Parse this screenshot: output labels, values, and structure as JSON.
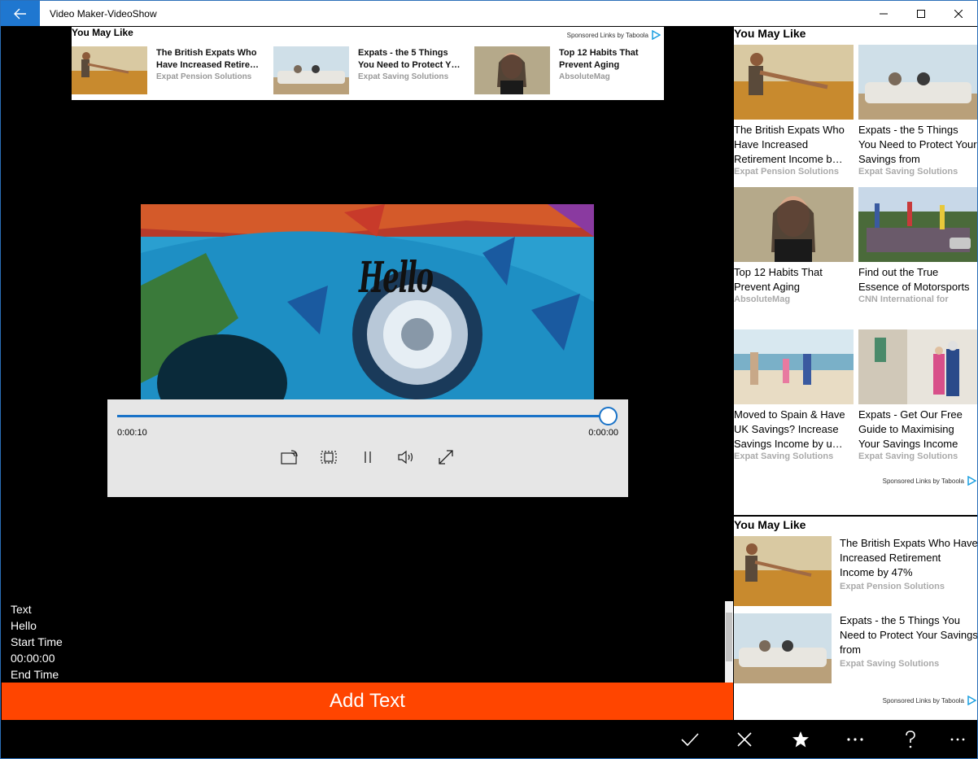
{
  "window": {
    "title": "Video Maker-VideoShow",
    "accent": "#1f77d0"
  },
  "top_ad": {
    "heading": "You May Like",
    "sponsored": "Sponsored Links by Taboola",
    "items": [
      {
        "title": "The British Expats Who Have Increased Retire…",
        "source": "Expat Pension Solutions",
        "image": "wheat-field-man"
      },
      {
        "title": "Expats - the 5 Things You Need to Protect Y…",
        "source": "Expat Saving Solutions",
        "image": "convertible-car"
      },
      {
        "title": "Top 12 Habits That Prevent Aging",
        "source": "AbsoluteMag",
        "image": "smiling-woman"
      }
    ]
  },
  "video": {
    "overlay_text": "Hello",
    "elapsed": "0:00:10",
    "remaining": "0:00:00",
    "progress": 1.0
  },
  "media_controls": {
    "buttons": [
      "cast-icon",
      "aspect-ratio-icon",
      "pause-icon",
      "volume-icon",
      "fullscreen-icon"
    ]
  },
  "text_info": {
    "label_text": "Text",
    "text_value": "Hello",
    "label_start": "Start Time",
    "start_value": "00:00:00",
    "label_end": "End Time"
  },
  "add_text_button": {
    "label": "Add Text",
    "color": "#ff4500"
  },
  "side_ad": {
    "heading": "You May Like",
    "sponsored": "Sponsored Links by Taboola",
    "cards": [
      {
        "title": "The British Expats Who Have Increased Retirement Income b…",
        "source": "Expat Pension Solutions",
        "image": "wheat-field-man"
      },
      {
        "title": "Expats - the 5 Things You Need to Protect Your Savings from",
        "source": "Expat Saving Solutions",
        "image": "convertible-car"
      },
      {
        "title": "Top 12 Habits That Prevent Aging",
        "source": "AbsoluteMag",
        "image": "smiling-woman"
      },
      {
        "title": "Find out the True Essence of Motorsports",
        "source": "CNN International for",
        "image": "rally-crowd"
      },
      {
        "title": "Moved to Spain & Have UK Savings? Increase Savings Income by u…",
        "source": "Expat Saving Solutions",
        "image": "beach-family"
      },
      {
        "title": "Expats - Get Our Free Guide to Maximising Your Savings Income",
        "source": "Expat Saving Solutions",
        "image": "old-couple-street"
      }
    ]
  },
  "side_ad2": {
    "heading": "You May Like",
    "sponsored": "Sponsored Links by Taboola",
    "rows": [
      {
        "title": "The British Expats Who Have Increased Retirement Income by 47%",
        "source": "Expat Pension Solutions",
        "image": "wheat-field-man"
      },
      {
        "title": "Expats - the 5 Things You Need to Protect Your Savings from",
        "source": "Expat Saving Solutions",
        "image": "convertible-car"
      }
    ]
  },
  "command_bar": {
    "buttons": [
      "check-icon",
      "close-icon",
      "star-icon",
      "more-icon",
      "help-icon",
      "overflow-icon"
    ]
  }
}
